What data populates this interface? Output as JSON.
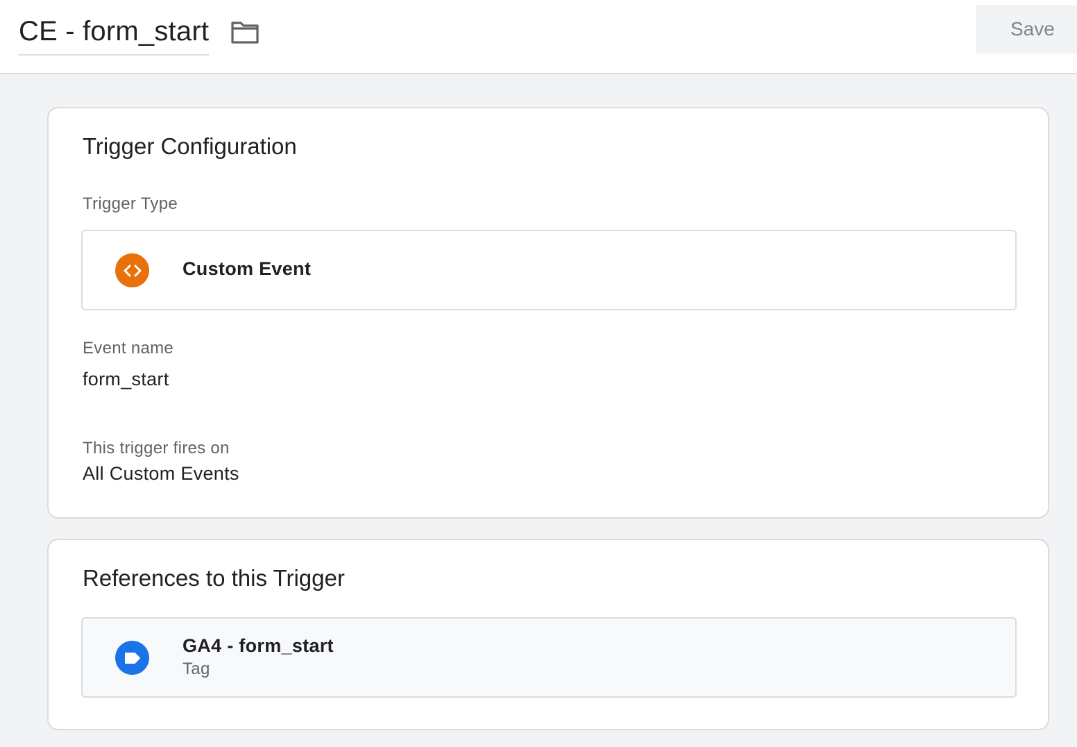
{
  "header": {
    "title": "CE - form_start",
    "folder_icon": "folder-icon",
    "save_label": "Save"
  },
  "trigger_config": {
    "heading": "Trigger Configuration",
    "type_label": "Trigger Type",
    "type_value": "Custom Event",
    "type_icon": "code-brackets-icon",
    "type_icon_color": "#e8710a",
    "event_name_label": "Event name",
    "event_name_value": "form_start",
    "fires_on_label": "This trigger fires on",
    "fires_on_value": "All Custom Events"
  },
  "references": {
    "heading": "References to this Trigger",
    "items": [
      {
        "name": "GA4 - form_start",
        "kind": "Tag",
        "icon": "tag-icon",
        "icon_color": "#1a73e8"
      }
    ]
  }
}
